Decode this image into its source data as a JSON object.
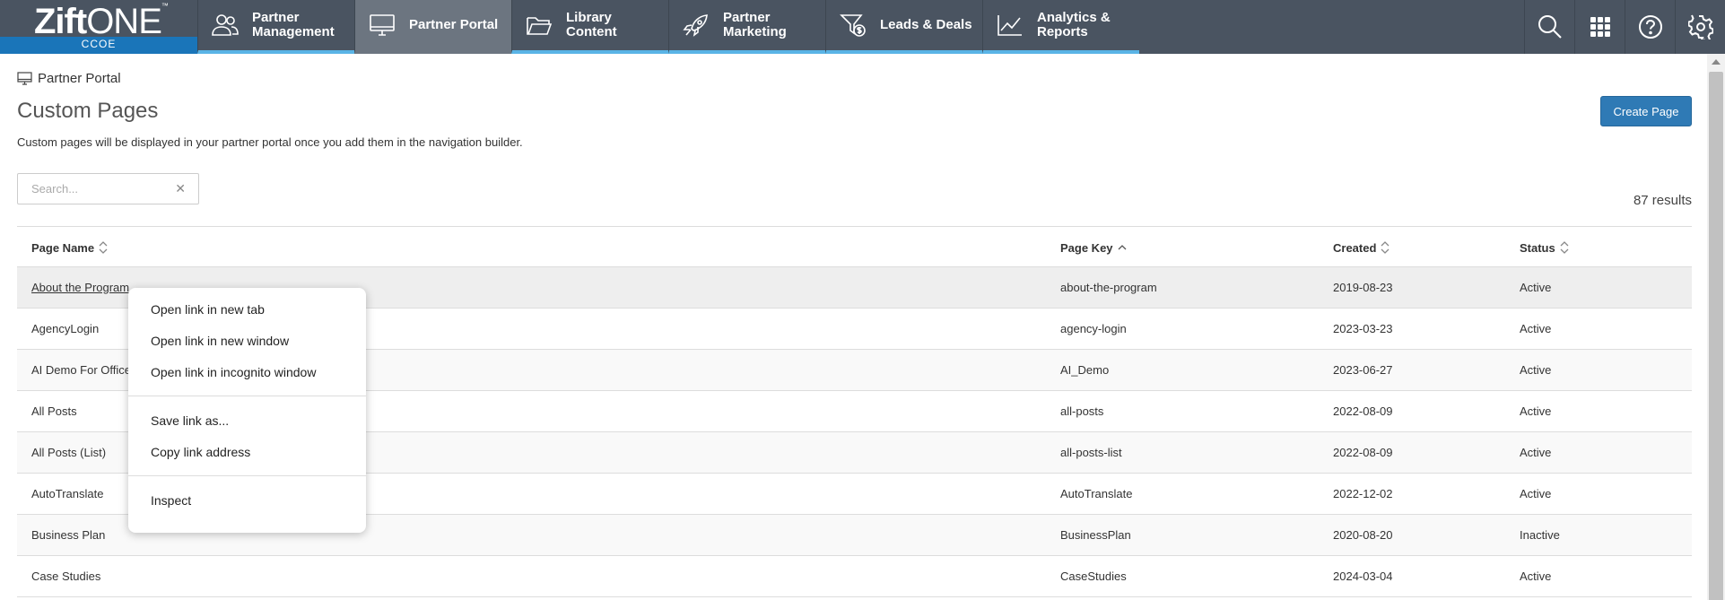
{
  "brand": {
    "name_bold": "Zift",
    "name_light": "ONE",
    "trademark": "™",
    "sub": "CCOE"
  },
  "nav": {
    "tabs": [
      {
        "label": "Partner Management",
        "icon": "people-icon"
      },
      {
        "label": "Partner Portal",
        "icon": "monitor-icon",
        "active": true
      },
      {
        "label": "Library Content",
        "icon": "folder-icon"
      },
      {
        "label": "Partner Marketing",
        "icon": "rocket-icon"
      },
      {
        "label": "Leads & Deals",
        "icon": "funnel-dollar-icon"
      },
      {
        "label": "Analytics & Reports",
        "icon": "line-chart-icon"
      }
    ],
    "right_icons": [
      "search-icon",
      "grid-icon",
      "help-icon",
      "gear-icon"
    ]
  },
  "breadcrumb": {
    "label": "Partner Portal",
    "icon": "monitor-icon"
  },
  "page": {
    "title": "Custom Pages",
    "description": "Custom pages will be displayed in your partner portal once you add them in the navigation builder.",
    "create_button": "Create Page"
  },
  "search": {
    "placeholder": "Search...",
    "value": "",
    "clear": "✕"
  },
  "results_text": "87 results",
  "table": {
    "columns": [
      "Page Name",
      "Page Key",
      "Created",
      "Status"
    ],
    "sorted_column": "Page Key",
    "rows": [
      [
        "About the Program",
        "about-the-program",
        "2019-08-23",
        "Active"
      ],
      [
        "AgencyLogin",
        "agency-login",
        "2023-03-23",
        "Active"
      ],
      [
        "AI Demo For Office",
        "AI_Demo",
        "2023-06-27",
        "Active"
      ],
      [
        "All Posts",
        "all-posts",
        "2022-08-09",
        "Active"
      ],
      [
        "All Posts (List)",
        "all-posts-list",
        "2022-08-09",
        "Active"
      ],
      [
        "AutoTranslate",
        "AutoTranslate",
        "2022-12-02",
        "Active"
      ],
      [
        "Business Plan",
        "BusinessPlan",
        "2020-08-20",
        "Inactive"
      ],
      [
        "Case Studies",
        "CaseStudies",
        "2024-03-04",
        "Active"
      ]
    ]
  },
  "context_menu": {
    "group1": [
      "Open link in new tab",
      "Open link in new window",
      "Open link in incognito window"
    ],
    "group2": [
      "Save link as...",
      "Copy link address"
    ],
    "group3": [
      "Inspect"
    ]
  },
  "colors": {
    "nav_bg": "#4a5461",
    "nav_active": "#6c7580",
    "accent": "#5ab4e6",
    "brand_blue": "#1a75b9",
    "button": "#2f7ab5"
  }
}
